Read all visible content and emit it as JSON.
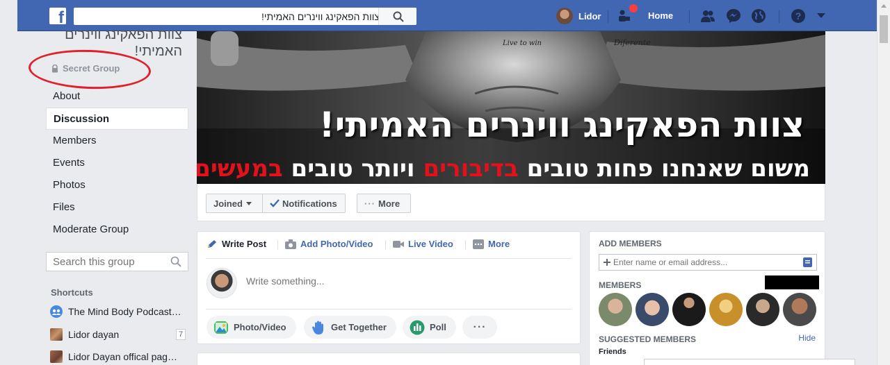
{
  "topbar": {
    "search_value": "צוות הפאקינג ווינרים האמיתי!",
    "user_name": "Lidor",
    "home_label": "Home",
    "brand_color": "#4267b2",
    "notification_color": "#fa3e3e"
  },
  "group": {
    "title": "צוות הפאקינג ווינרים האמיתי!",
    "privacy": "Secret Group",
    "annotation_color": "#e0202a"
  },
  "sidebar": {
    "items": [
      {
        "label": "About"
      },
      {
        "label": "Discussion",
        "active": true
      },
      {
        "label": "Members"
      },
      {
        "label": "Events"
      },
      {
        "label": "Photos"
      },
      {
        "label": "Files"
      },
      {
        "label": "Moderate Group"
      }
    ],
    "search_placeholder": "Search this group",
    "shortcuts_heading": "Shortcuts",
    "shortcuts": [
      {
        "label": "The Mind Body Podcast…",
        "icon": "group-icon"
      },
      {
        "label": "Lidor dayan",
        "icon": "profile-thumb",
        "badge": "7"
      },
      {
        "label": "Lidor Dayan offical pag…",
        "icon": "page-thumb"
      }
    ]
  },
  "cover": {
    "headline": "צוות הפאקינג ווינרים האמיתי!",
    "tagline_white_1": "משום שאנחנו פחות טובים",
    "tagline_red_1": "בדיבורים",
    "tagline_white_2": "ויותר טובים",
    "tagline_red_2": "במעשים!",
    "tattoo_left": "Live to win",
    "tattoo_right": "Diferente"
  },
  "actions": {
    "joined_label": "Joined",
    "notifications_label": "Notifications",
    "more_label": "More"
  },
  "composer": {
    "tabs": [
      {
        "label": "Write Post",
        "icon": "pencil-icon"
      },
      {
        "label": "Add Photo/Video",
        "icon": "camera-icon"
      },
      {
        "label": "Live Video",
        "icon": "video-icon"
      },
      {
        "label": "More",
        "icon": "more-icon"
      }
    ],
    "placeholder": "Write something...",
    "pills": [
      {
        "label": "Photo/Video",
        "icon": "photo-icon"
      },
      {
        "label": "Get Together",
        "icon": "hand-icon"
      },
      {
        "label": "Poll",
        "icon": "poll-icon"
      }
    ]
  },
  "right": {
    "add_members_heading": "ADD MEMBERS",
    "add_members_placeholder": "Enter name or email address...",
    "members_heading": "MEMBERS",
    "suggested_heading": "SUGGESTED MEMBERS",
    "hide_label": "Hide",
    "friends_label": "Friends"
  }
}
